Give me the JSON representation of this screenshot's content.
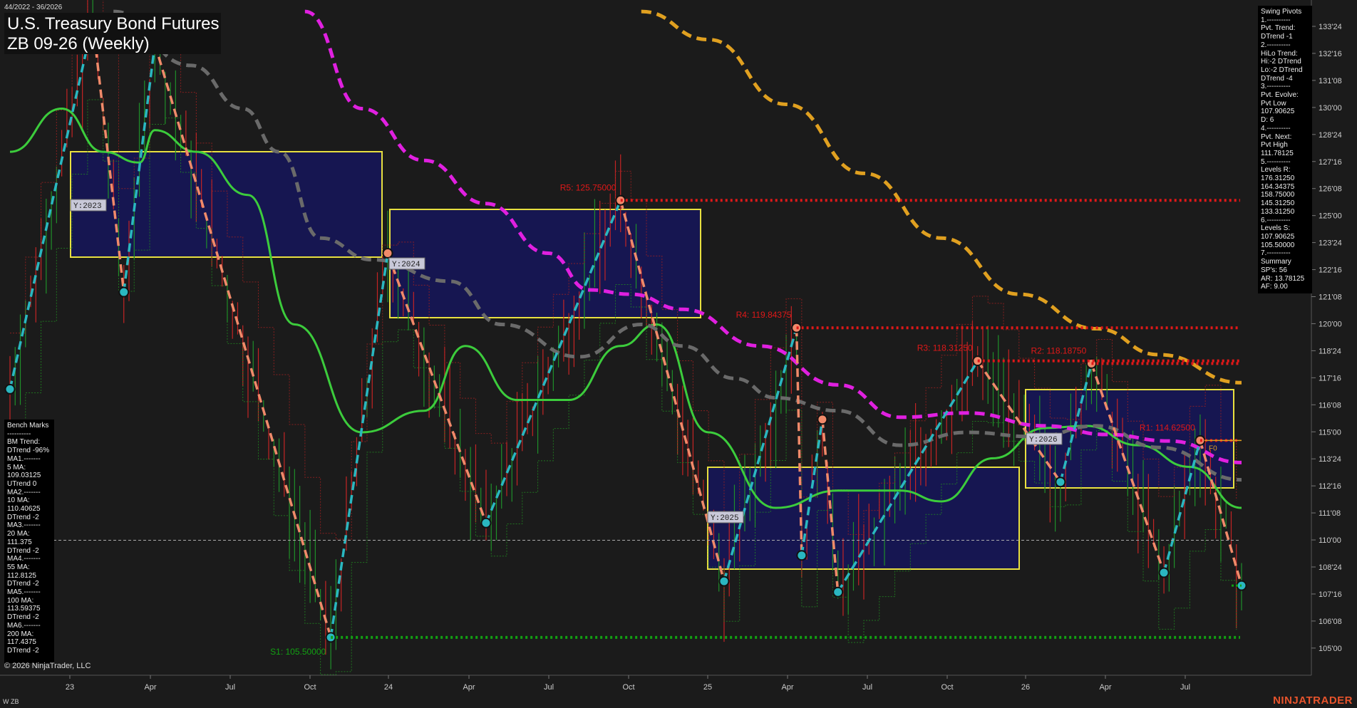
{
  "header": {
    "date_range": "44/2022 - 36/2026",
    "title": "U.S. Treasury Bond Futures",
    "subtitle": "ZB 09-26 (Weekly)"
  },
  "footer": {
    "copyright": "© 2026 NinjaTrader, LLC",
    "series_tag": "W ZB",
    "brand": "NINJATRADER"
  },
  "swing_pivots": [
    "Swing Pivots",
    "1.----------",
    "Pvt. Trend:",
    "DTrend -1",
    "2.----------",
    "HiLo Trend:",
    "Hi:-2 DTrend",
    "Lo:-2 DTrend",
    "DTrend -4",
    "3.----------",
    "Pvt. Evolve:",
    "Pvt Low",
    "107.90625",
    "D: 6",
    "4.----------",
    "Pvt. Next:",
    "Pvt High",
    "111.78125",
    "5.----------",
    "Levels R:",
    "176.31250",
    "164.34375",
    "158.75000",
    "145.31250",
    "133.31250",
    "6.----------",
    "Levels S:",
    "107.90625",
    "105.50000",
    "7.----------",
    "Summary",
    "SP's: 56",
    "AR: 13.78125",
    "AF: 9.00"
  ],
  "bench_marks": [
    "Bench Marks",
    "----------",
    "BM Trend:",
    "DTrend -96%",
    "MA1.-------",
    "5 MA:",
    "109.03125",
    "UTrend 0",
    "MA2.-------",
    "10 MA:",
    "110.40625",
    "DTrend -2",
    "MA3.-------",
    "20 MA:",
    "111.375",
    "DTrend -2",
    "MA4.-------",
    "55 MA:",
    "112.8125",
    "DTrend -2",
    "MA5.-------",
    "100 MA:",
    "113.59375",
    "DTrend -2",
    "MA6.-------",
    "200 MA:",
    "117.4375",
    "DTrend -2"
  ],
  "colors": {
    "background": "#1b1b1b",
    "up_candle": "#1f8f2a",
    "down_candle": "#c42424",
    "ma_green": "#3ccc3c",
    "ma_gray": "#6a6a6a",
    "ma_magenta": "#e020e0",
    "ma_orange": "#e0a020",
    "swing_up": "#2ab7c0",
    "swing_down": "#f08a6a",
    "year_box_fill": "#15155a",
    "year_box_border": "#e8e040",
    "resistance": "#e01818",
    "support": "#12a012"
  },
  "chart_data": {
    "type": "candlestick",
    "title": "U.S. Treasury Bond Futures",
    "subtitle": "ZB 09-26 (Weekly)",
    "ylim": [
      104.0,
      134.5
    ],
    "y_ticks": [
      "133'24",
      "132'16",
      "131'08",
      "130'00",
      "128'24",
      "127'16",
      "126'08",
      "125'00",
      "123'24",
      "122'16",
      "121'08",
      "120'00",
      "118'24",
      "117'16",
      "116'08",
      "115'00",
      "113'24",
      "112'16",
      "111'08",
      "110'00",
      "108'24",
      "107'16",
      "106'08",
      "105'00"
    ],
    "x_ticks": [
      "23",
      "Apr",
      "Jul",
      "Oct",
      "24",
      "Apr",
      "Jul",
      "Oct",
      "25",
      "Apr",
      "Jul",
      "Oct",
      "26",
      "Apr",
      "Jul"
    ],
    "last_price": 110.0,
    "levels": [
      {
        "label": "R5: 125.75000",
        "value": 125.75,
        "kind": "resistance"
      },
      {
        "label": "R4: 119.84375",
        "value": 119.84375,
        "kind": "resistance"
      },
      {
        "label": "R3: 118.31250",
        "value": 118.3125,
        "kind": "resistance"
      },
      {
        "label": "R2: 118.18750",
        "value": 118.1875,
        "kind": "resistance"
      },
      {
        "label": "R1: 114.62500",
        "value": 114.625,
        "kind": "resistance"
      },
      {
        "label": "S1: 105.50000",
        "value": 105.5,
        "kind": "support"
      }
    ],
    "fib_label": "F0",
    "year_boxes": [
      {
        "label": "Y:2023",
        "low": 123.0,
        "high": 128.0
      },
      {
        "label": "Y:2024",
        "low": 120.2,
        "high": 125.2
      },
      {
        "label": "Y:2025",
        "low": 108.5,
        "high": 113.2
      },
      {
        "label": "Y:2026",
        "low": 112.4,
        "high": 117.0
      }
    ],
    "swing_points": [
      {
        "week": 0,
        "price": 117.0,
        "type": "low"
      },
      {
        "week": 16,
        "price": 134.0,
        "type": "high"
      },
      {
        "week": 22,
        "price": 121.5,
        "type": "low"
      },
      {
        "week": 28,
        "price": 133.0,
        "type": "high"
      },
      {
        "week": 62,
        "price": 105.5,
        "type": "low"
      },
      {
        "week": 73,
        "price": 123.3,
        "type": "high"
      },
      {
        "week": 92,
        "price": 110.8,
        "type": "low"
      },
      {
        "week": 118,
        "price": 125.75,
        "type": "high"
      },
      {
        "week": 138,
        "price": 108.1,
        "type": "low"
      },
      {
        "week": 152,
        "price": 119.84375,
        "type": "high"
      },
      {
        "week": 153,
        "price": 109.3,
        "type": "low"
      },
      {
        "week": 157,
        "price": 115.6,
        "type": "high"
      },
      {
        "week": 160,
        "price": 107.6,
        "type": "low"
      },
      {
        "week": 187,
        "price": 118.3125,
        "type": "high"
      },
      {
        "week": 203,
        "price": 112.7,
        "type": "low"
      },
      {
        "week": 209,
        "price": 118.1875,
        "type": "high"
      },
      {
        "week": 223,
        "price": 108.5,
        "type": "low"
      },
      {
        "week": 230,
        "price": 114.625,
        "type": "high"
      },
      {
        "week": 238,
        "price": 107.9,
        "type": "low"
      }
    ],
    "series": [
      {
        "color": "ma_green",
        "values": [
          [
            0,
            128
          ],
          [
            10,
            130
          ],
          [
            18,
            128
          ],
          [
            25,
            127.5
          ],
          [
            28,
            129
          ],
          [
            36,
            128
          ],
          [
            46,
            126
          ],
          [
            55,
            120
          ],
          [
            68,
            115
          ],
          [
            80,
            116
          ],
          [
            88,
            119
          ],
          [
            98,
            116.5
          ],
          [
            108,
            116.5
          ],
          [
            118,
            119
          ],
          [
            125,
            120
          ],
          [
            135,
            115
          ],
          [
            148,
            111.5
          ],
          [
            160,
            112.3
          ],
          [
            172,
            112.3
          ],
          [
            180,
            111.8
          ],
          [
            190,
            113.8
          ],
          [
            200,
            115.2
          ],
          [
            208,
            115.3
          ],
          [
            218,
            114.4
          ],
          [
            228,
            113.4
          ],
          [
            238,
            111.5
          ]
        ]
      },
      {
        "color": "ma_gray",
        "values": [
          [
            20,
            134.5
          ],
          [
            35,
            132
          ],
          [
            45,
            130
          ],
          [
            52,
            128
          ],
          [
            60,
            124
          ],
          [
            70,
            123
          ],
          [
            85,
            122
          ],
          [
            95,
            120
          ],
          [
            110,
            118.5
          ],
          [
            122,
            120
          ],
          [
            130,
            119
          ],
          [
            140,
            117.5
          ],
          [
            148,
            116.6
          ],
          [
            160,
            116
          ],
          [
            172,
            114.4
          ],
          [
            185,
            115
          ],
          [
            198,
            114.8
          ],
          [
            210,
            115.3
          ],
          [
            222,
            114.3
          ],
          [
            238,
            112.8
          ]
        ]
      },
      {
        "color": "ma_magenta",
        "values": [
          [
            57,
            134.5
          ],
          [
            68,
            130
          ],
          [
            80,
            127.6
          ],
          [
            92,
            125.6
          ],
          [
            104,
            123.3
          ],
          [
            112,
            121.6
          ],
          [
            120,
            121.4
          ],
          [
            130,
            120.7
          ],
          [
            145,
            119
          ],
          [
            160,
            117.2
          ],
          [
            172,
            115.7
          ],
          [
            185,
            115.9
          ],
          [
            200,
            115.3
          ],
          [
            212,
            114.9
          ],
          [
            224,
            114.6
          ],
          [
            238,
            113.6
          ]
        ]
      },
      {
        "color": "ma_orange",
        "values": [
          [
            122,
            134.5
          ],
          [
            135,
            133.2
          ],
          [
            150,
            130.2
          ],
          [
            165,
            127
          ],
          [
            180,
            124
          ],
          [
            195,
            121.4
          ],
          [
            210,
            119.8
          ],
          [
            222,
            118.6
          ],
          [
            238,
            117.3
          ]
        ]
      }
    ]
  }
}
